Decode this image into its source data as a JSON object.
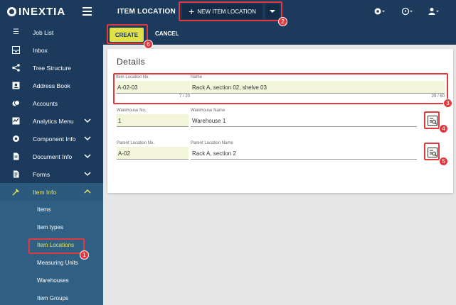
{
  "brand": {
    "name": "INEXTIA"
  },
  "sidebar": {
    "items": [
      {
        "label": "Job List",
        "icon": "checklist-icon"
      },
      {
        "label": "Inbox",
        "icon": "inbox-icon"
      },
      {
        "label": "Tree Structure",
        "icon": "share-icon"
      },
      {
        "label": "Address Book",
        "icon": "contact-icon"
      },
      {
        "label": "Accounts",
        "icon": "coins-icon"
      },
      {
        "label": "Analytics Menu",
        "icon": "analytics-icon"
      },
      {
        "label": "Component Info",
        "icon": "gear-icon"
      },
      {
        "label": "Document Info",
        "icon": "document-icon"
      },
      {
        "label": "Forms",
        "icon": "form-icon"
      },
      {
        "label": "Item Info",
        "icon": "hammer-icon"
      }
    ],
    "subitems": [
      {
        "label": "Items"
      },
      {
        "label": "Item types"
      },
      {
        "label": "Item Locations"
      },
      {
        "label": "Measuring Units"
      },
      {
        "label": "Warehouses"
      },
      {
        "label": "Item Groups"
      }
    ]
  },
  "header": {
    "title": "ITEM LOCATION",
    "new_button": "NEW ITEM LOCATION"
  },
  "actions": {
    "create": "CREATE",
    "cancel": "CANCEL"
  },
  "details": {
    "title": "Details",
    "item_location_no": {
      "label": "Item Location No.",
      "value": "A-02-03",
      "counter": "7 / 20"
    },
    "name": {
      "label": "Name",
      "value": "Rack A, section 02, shelve 03",
      "counter": "29 / 60"
    },
    "warehouse_no": {
      "label": "Warehouse No.",
      "value": "1"
    },
    "warehouse_name": {
      "label": "Warehouse Name",
      "value": "Warehouse 1"
    },
    "parent_location_no": {
      "label": "Parent Location No.",
      "value": "A-02"
    },
    "parent_location_name": {
      "label": "Parent Location Name",
      "value": "Rack A, section 2"
    }
  },
  "annotations": [
    "1",
    "2",
    "3",
    "4",
    "5",
    "6"
  ],
  "colors": {
    "nav": "#1b3a5c",
    "accent": "#e0e04a",
    "annotation": "#e0393e",
    "input_bg": "#f2f5da"
  }
}
